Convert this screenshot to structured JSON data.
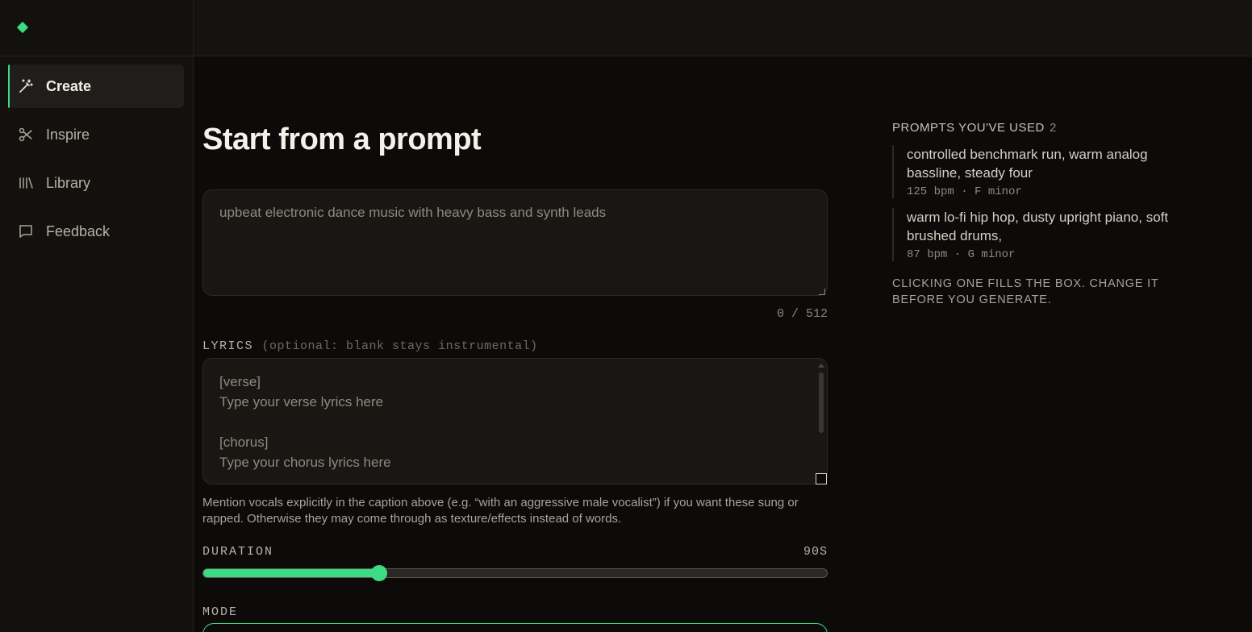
{
  "brand": {
    "logo_icon": "diamond-icon",
    "accent": "#3ddc84"
  },
  "sidebar": {
    "items": [
      {
        "label": "Create",
        "icon": "magic-wand-icon",
        "active": true
      },
      {
        "label": "Inspire",
        "icon": "scissors-icon",
        "active": false
      },
      {
        "label": "Library",
        "icon": "library-icon",
        "active": false
      },
      {
        "label": "Feedback",
        "icon": "message-square-icon",
        "active": false
      }
    ]
  },
  "main": {
    "title": "Start from a prompt",
    "prompt": {
      "value": "",
      "placeholder": "upbeat electronic dance music with heavy bass and synth leads",
      "char_count": "0 / 512"
    },
    "lyrics": {
      "label": "LYRICS",
      "optional_note": "(optional: blank stays instrumental)",
      "lines": [
        "[verse]",
        "Type your verse lyrics here",
        "",
        "[chorus]",
        "Type your chorus lyrics here"
      ]
    },
    "vocal_hint": "Mention vocals explicitly in the caption above (e.g. “with an aggressive male vocalist”) if you want these sung or rapped. Otherwise they may come through as texture/effects instead of words.",
    "duration": {
      "label": "DURATION",
      "value_label": "90S",
      "fraction": 0.282
    },
    "mode": {
      "label": "MODE"
    }
  },
  "history": {
    "heading": "PROMPTS YOU'VE USED",
    "count": "2",
    "items": [
      {
        "text": "controlled benchmark run, warm analog bassline, steady four",
        "meta": "125 bpm · F minor"
      },
      {
        "text": "warm lo-fi hip hop, dusty upright piano, soft brushed drums,",
        "meta": "87 bpm · G minor"
      }
    ],
    "note": "CLICKING ONE FILLS THE BOX. CHANGE IT BEFORE YOU GENERATE."
  }
}
